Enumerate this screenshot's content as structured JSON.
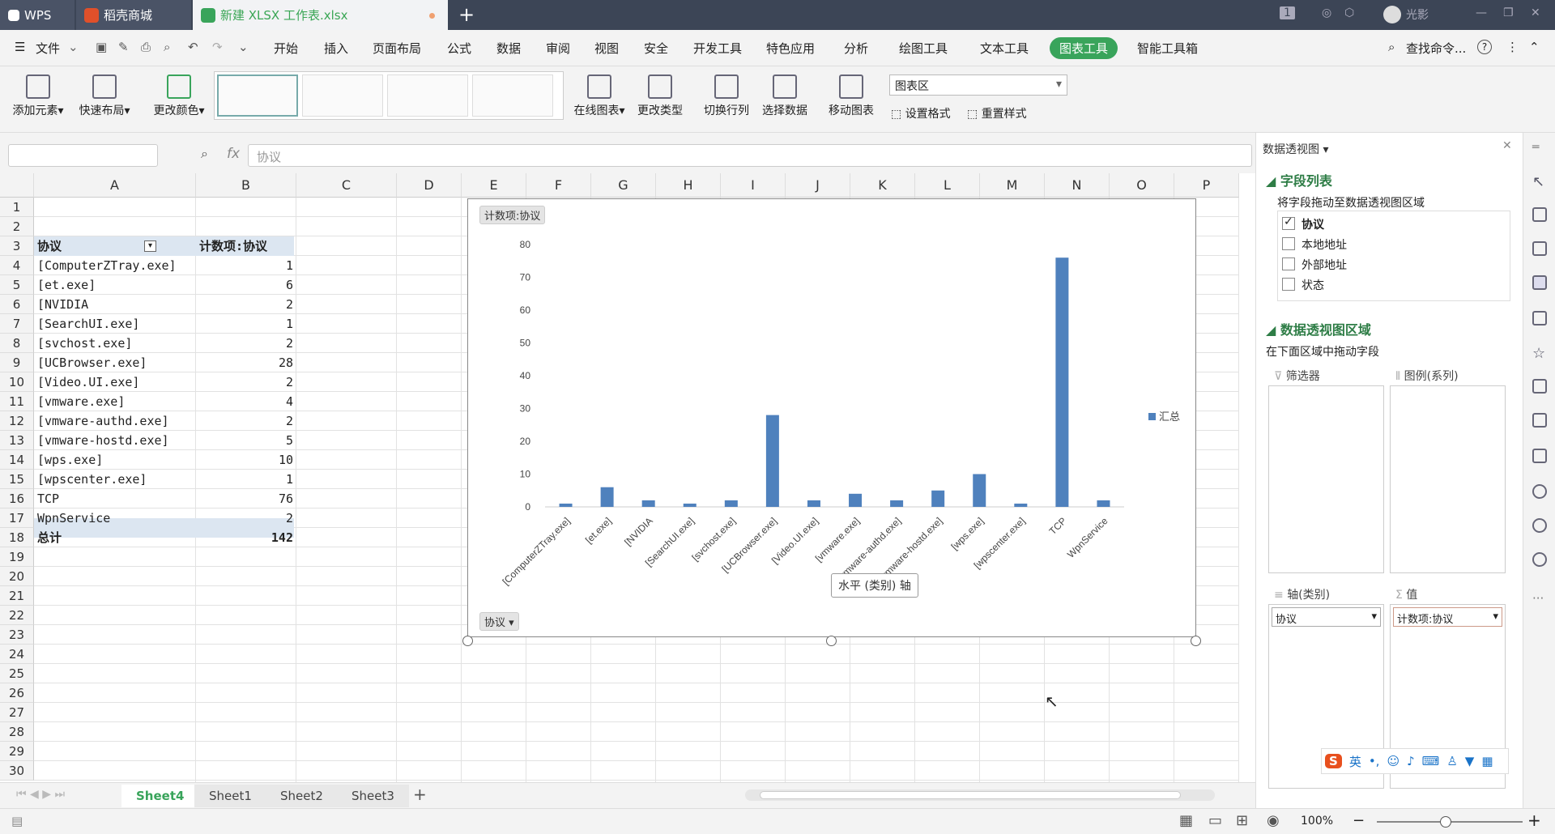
{
  "tabs": {
    "wps": "WPS",
    "shop": "稻壳商城",
    "file": "新建 XLSX 工作表.xlsx",
    "num": "1",
    "user": "光影"
  },
  "menu": {
    "file": "文件",
    "items": [
      "开始",
      "插入",
      "页面布局",
      "公式",
      "数据",
      "审阅",
      "视图",
      "安全",
      "开发工具",
      "特色应用",
      "分析",
      "绘图工具",
      "文本工具",
      "图表工具",
      "智能工具箱"
    ],
    "active": "图表工具",
    "search": "查找命令..."
  },
  "ribbon": {
    "add_element": "添加元素",
    "quick_layout": "快速布局",
    "change_color": "更改颜色",
    "online_chart": "在线图表",
    "change_type": "更改类型",
    "switch_rowcol": "切换行列",
    "select_data": "选择数据",
    "move_chart": "移动图表",
    "chart_area_combo": "图表区",
    "set_format": "设置格式",
    "reset_style": "重置样式"
  },
  "formula_bar": {
    "fx": "fx",
    "content": "协议"
  },
  "columns": [
    "A",
    "B",
    "C",
    "D",
    "E",
    "F",
    "G",
    "H",
    "I",
    "J",
    "K",
    "L",
    "M",
    "N",
    "O",
    "P"
  ],
  "rows": [
    "1",
    "2",
    "3",
    "4",
    "5",
    "6",
    "7",
    "8",
    "9",
    "10",
    "11",
    "12",
    "13",
    "14",
    "15",
    "16",
    "17",
    "18",
    "19",
    "20",
    "21",
    "22",
    "23",
    "24",
    "25",
    "26",
    "27",
    "28",
    "29",
    "30"
  ],
  "pivot": {
    "header_a": "协议",
    "header_b": "计数项:协议",
    "items": [
      {
        "name": "[ComputerZTray.exe]",
        "count": "1"
      },
      {
        "name": "[et.exe]",
        "count": "6"
      },
      {
        "name": "[NVIDIA",
        "count": "2"
      },
      {
        "name": "[SearchUI.exe]",
        "count": "1"
      },
      {
        "name": "[svchost.exe]",
        "count": "2"
      },
      {
        "name": "[UCBrowser.exe]",
        "count": "28"
      },
      {
        "name": "[Video.UI.exe]",
        "count": "2"
      },
      {
        "name": "[vmware.exe]",
        "count": "4"
      },
      {
        "name": "[vmware-authd.exe]",
        "count": "2"
      },
      {
        "name": "[vmware-hostd.exe]",
        "count": "5"
      },
      {
        "name": "[wps.exe]",
        "count": "10"
      },
      {
        "name": "[wpscenter.exe]",
        "count": "1"
      },
      {
        "name": "TCP",
        "count": "76"
      },
      {
        "name": "WpnService",
        "count": "2"
      }
    ],
    "total_label": "总计",
    "total_value": "142"
  },
  "chart_data": {
    "type": "bar",
    "categories": [
      "[ComputerZTray.exe]",
      "[et.exe]",
      "[NVIDIA",
      "[SearchUI.exe]",
      "[svchost.exe]",
      "[UCBrowser.exe]",
      "[Video.UI.exe]",
      "[vmware.exe]",
      "[vmware-authd.exe]",
      "[vmware-hostd.exe]",
      "[wps.exe]",
      "[wpscenter.exe]",
      "TCP",
      "WpnService"
    ],
    "series": [
      {
        "name": "汇总",
        "values": [
          1,
          6,
          2,
          1,
          2,
          28,
          2,
          4,
          2,
          5,
          10,
          1,
          76,
          2
        ]
      }
    ],
    "yticks": [
      "0",
      "10",
      "20",
      "30",
      "40",
      "50",
      "60",
      "70",
      "80"
    ],
    "ylim": [
      0,
      80
    ],
    "color": "#4f81bd",
    "legend": "right",
    "value_field_button": "计数项:协议",
    "axis_field_button": "协议",
    "tooltip": "水平 (类别) 轴"
  },
  "sheets": [
    "Sheet4",
    "Sheet1",
    "Sheet2",
    "Sheet3"
  ],
  "active_sheet": "Sheet4",
  "status": {
    "zoom": "100%"
  },
  "panel": {
    "title": "数据透视图",
    "field_list": "字段列表",
    "field_hint": "将字段拖动至数据透视图区域",
    "fields": [
      {
        "name": "协议",
        "checked": true
      },
      {
        "name": "本地地址",
        "checked": false
      },
      {
        "name": "外部地址",
        "checked": false
      },
      {
        "name": "状态",
        "checked": false
      }
    ],
    "area_title": "数据透视图区域",
    "area_hint": "在下面区域中拖动字段",
    "filter": "筛选器",
    "legend_series": "图例(系列)",
    "axis": "轴(类别)",
    "values": "值",
    "axis_item": "协议",
    "value_item": "计数项:协议"
  },
  "ime": {
    "lang": "英"
  }
}
